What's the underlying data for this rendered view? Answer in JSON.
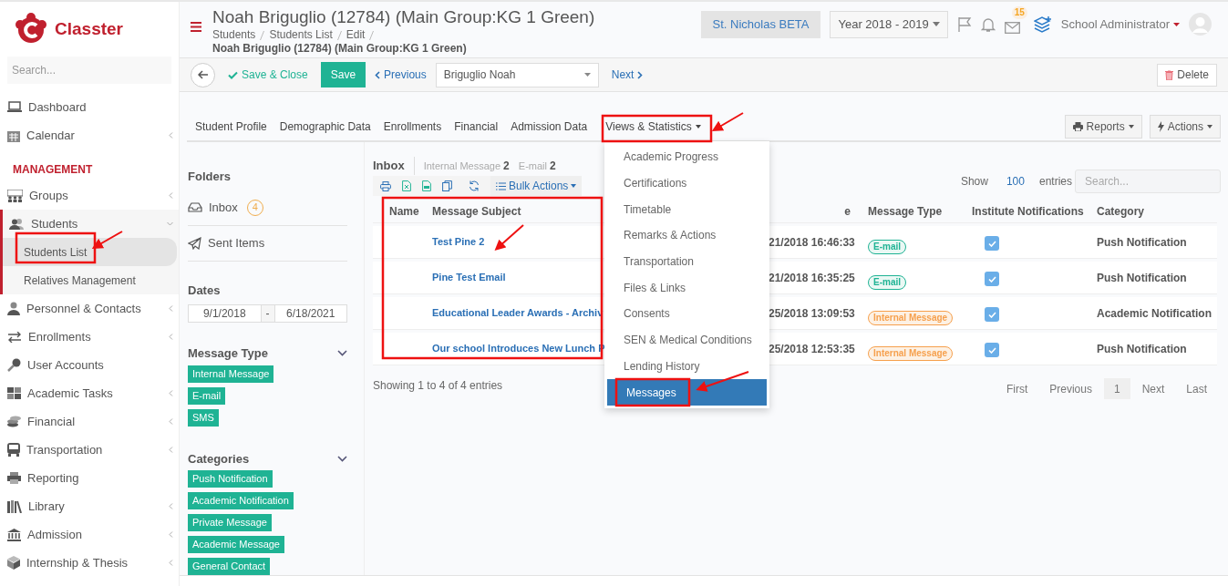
{
  "logo": {
    "text": "Classter"
  },
  "sidebar": {
    "search": {
      "placeholder": "Search..."
    },
    "items": [
      {
        "kind": "link",
        "label": "Dashboard",
        "has_submenu": false
      },
      {
        "kind": "link",
        "label": "Calendar",
        "has_submenu": true
      },
      {
        "kind": "heading",
        "label": "MANAGEMENT"
      },
      {
        "kind": "link",
        "label": "Groups",
        "has_submenu": true
      },
      {
        "kind": "link",
        "label": "Students",
        "has_submenu": true,
        "expanded": true,
        "children": [
          {
            "label": "Students List",
            "selected": true
          },
          {
            "label": "Relatives Management",
            "selected": false
          }
        ]
      },
      {
        "kind": "link",
        "label": "Personnel & Contacts",
        "has_submenu": true
      },
      {
        "kind": "link",
        "label": "Enrollments",
        "has_submenu": true
      },
      {
        "kind": "link",
        "label": "User Accounts",
        "has_submenu": false
      },
      {
        "kind": "link",
        "label": "Academic Tasks",
        "has_submenu": true
      },
      {
        "kind": "link",
        "label": "Financial",
        "has_submenu": true
      },
      {
        "kind": "link",
        "label": "Transportation",
        "has_submenu": true
      },
      {
        "kind": "link",
        "label": "Reporting",
        "has_submenu": false
      },
      {
        "kind": "link",
        "label": "Library",
        "has_submenu": true
      },
      {
        "kind": "link",
        "label": "Admission",
        "has_submenu": true
      },
      {
        "kind": "link",
        "label": "Internship & Thesis",
        "has_submenu": true
      }
    ]
  },
  "header": {
    "title": "Noah Briguglio (12784) (Main Group:KG 1 Green)",
    "breadcrumb": [
      "Students",
      "Students List",
      "Edit",
      "Noah Briguglio (12784) (Main Group:KG 1 Green)"
    ],
    "school": "St. Nicholas BETA",
    "year": "Year 2018 - 2019",
    "mail_count": "15",
    "user": "School Administrator"
  },
  "toolbar": {
    "save_close": "Save & Close",
    "save": "Save",
    "previous": "Previous",
    "student": "Briguglio Noah",
    "next": "Next",
    "delete": "Delete"
  },
  "tabs": [
    {
      "label": "Student Profile",
      "open": false,
      "dropdown": false
    },
    {
      "label": "Demographic Data",
      "open": false,
      "dropdown": false
    },
    {
      "label": "Enrollments",
      "open": false,
      "dropdown": false
    },
    {
      "label": "Financial",
      "open": false,
      "dropdown": false
    },
    {
      "label": "Admission Data",
      "open": false,
      "dropdown": false
    },
    {
      "label": "Views & Statistics",
      "open": true,
      "dropdown": true
    }
  ],
  "tab_buttons": [
    "Reports",
    "Actions"
  ],
  "views_menu": [
    {
      "label": "Academic Progress",
      "selected": false
    },
    {
      "label": "Certifications",
      "selected": false
    },
    {
      "label": "Timetable",
      "selected": false
    },
    {
      "label": "Remarks & Actions",
      "selected": false
    },
    {
      "label": "Transportation",
      "selected": false
    },
    {
      "label": "Files & Links",
      "selected": false
    },
    {
      "label": "Consents",
      "selected": false
    },
    {
      "label": "SEN & Medical Conditions",
      "selected": false
    },
    {
      "label": "Lending History",
      "selected": false
    },
    {
      "label": "Messages",
      "selected": true
    }
  ],
  "folders": {
    "heading": "Folders",
    "items": [
      {
        "kind": "inbox",
        "label": "Inbox",
        "count": "4"
      },
      {
        "kind": "sent",
        "label": "Sent Items"
      }
    ]
  },
  "dates": {
    "heading": "Dates",
    "from": "9/1/2018",
    "separator": "-",
    "to": "6/18/2021"
  },
  "message_type": {
    "heading": "Message Type",
    "tags": [
      "Internal Message",
      "E-mail",
      "SMS"
    ]
  },
  "categories": {
    "heading": "Categories",
    "tags": [
      "Push Notification",
      "Academic Notification",
      "Private Message",
      "Academic Message",
      "General Contact"
    ]
  },
  "inbox": {
    "title": "Inbox",
    "counts": [
      {
        "label": "Internal Message",
        "count": "2"
      },
      {
        "label": "E-mail",
        "count": "2"
      }
    ],
    "bulk_actions": "Bulk Actions",
    "show": "Show",
    "entries_value": "100",
    "entries": "entries",
    "search": {
      "placeholder": "Search..."
    }
  },
  "table": {
    "columns": [
      "Name",
      "Message Subject",
      "e",
      "Message Type",
      "Institute Notifications",
      "Category"
    ],
    "rows": [
      {
        "subject": "Test Pine 2",
        "date": "21/2018 16:46:33",
        "type": {
          "kind": "email",
          "label": "E-mail"
        },
        "notified": true,
        "category": "Push Notification"
      },
      {
        "subject": "Pine Test Email",
        "date": "21/2018 16:35:25",
        "type": {
          "kind": "email",
          "label": "E-mail"
        },
        "notified": true,
        "category": "Push Notification"
      },
      {
        "subject": "Educational Leader Awards - Archiv",
        "date": "25/2018 13:09:53",
        "type": {
          "kind": "internal",
          "label": "Internal Message"
        },
        "notified": true,
        "category": "Academic Notification"
      },
      {
        "subject": "Our school Introduces New Lunch P",
        "date": "25/2018 12:53:35",
        "type": {
          "kind": "internal",
          "label": "Internal Message"
        },
        "notified": true,
        "category": "Push Notification"
      }
    ]
  },
  "table_info": "Showing 1 to 4 of 4 entries",
  "pagination": [
    {
      "label": "First",
      "selected": false
    },
    {
      "label": "Previous",
      "selected": false
    },
    {
      "label": "1",
      "selected": true
    },
    {
      "label": "Next",
      "selected": false
    },
    {
      "label": "Last",
      "selected": false
    }
  ]
}
